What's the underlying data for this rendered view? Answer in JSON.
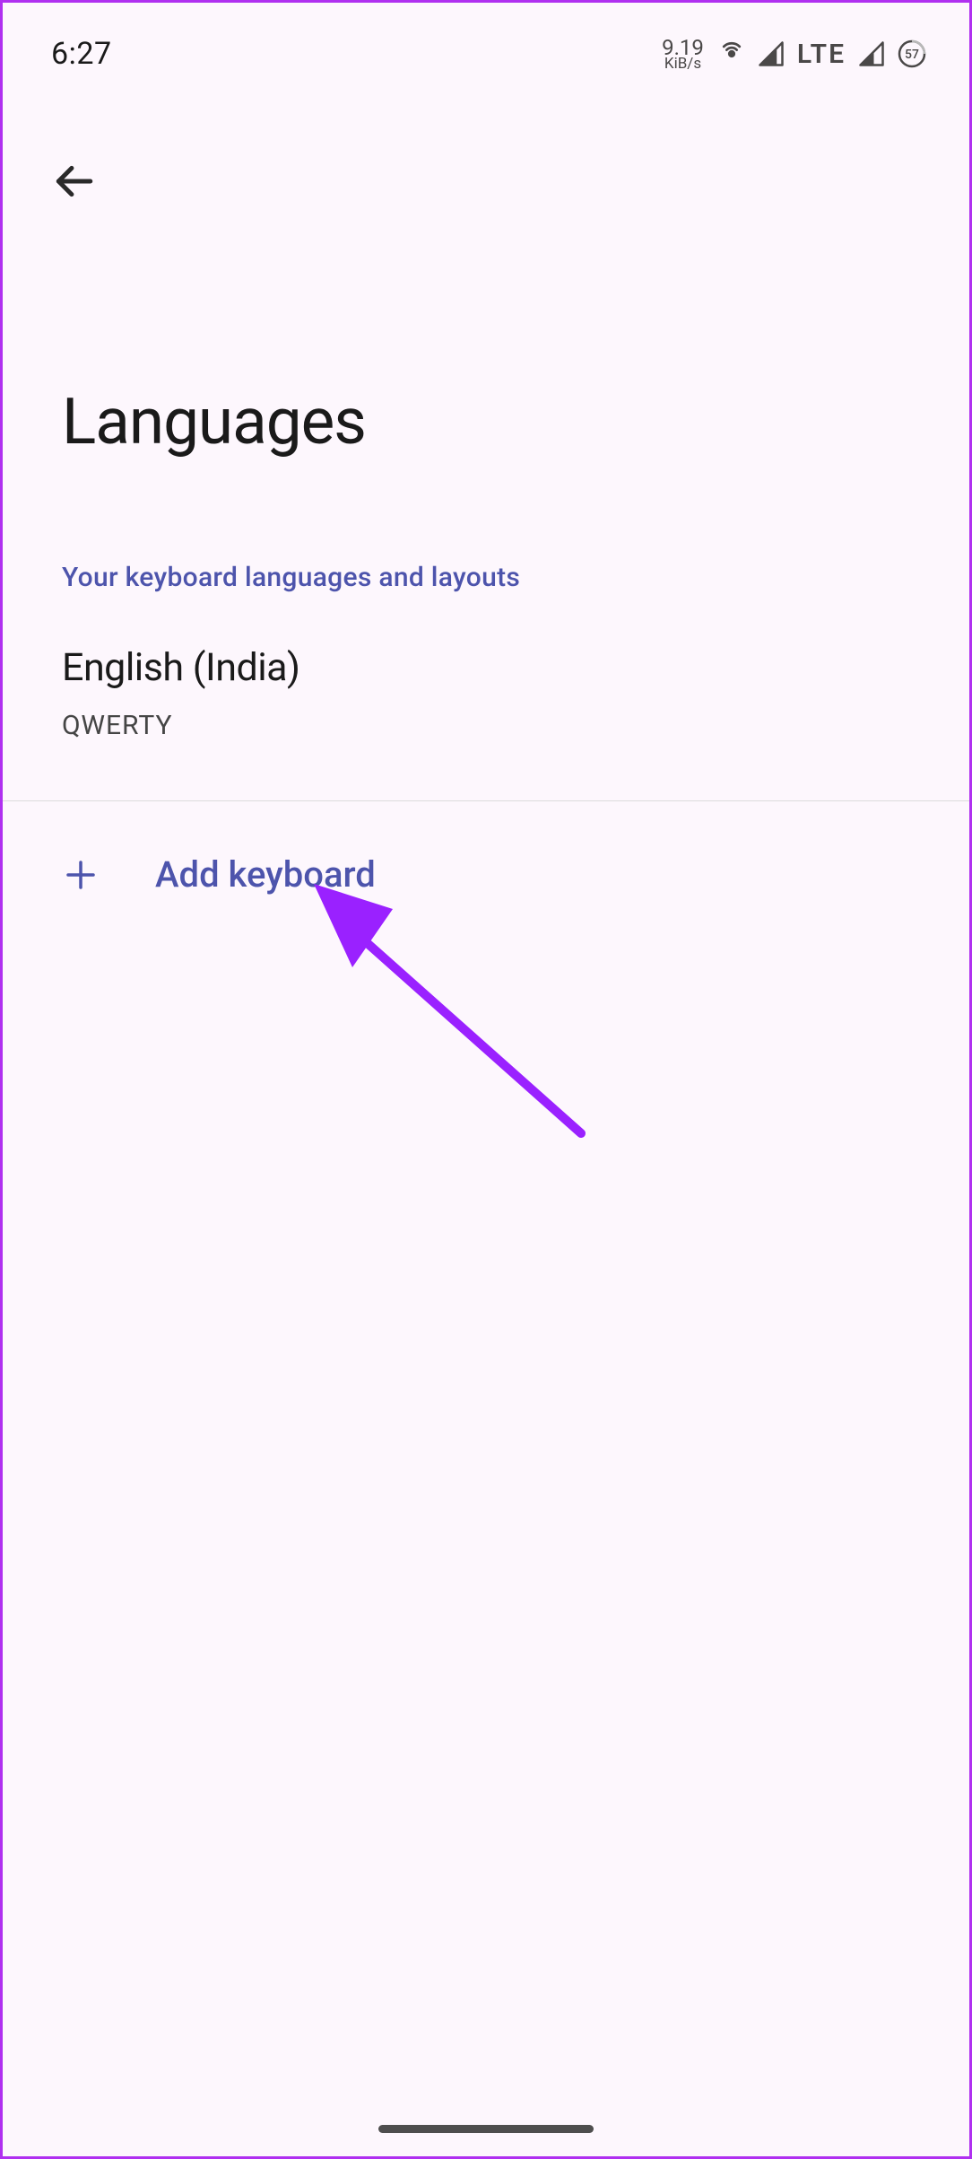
{
  "status_bar": {
    "time": "6:27",
    "data_rate_value": "9.19",
    "data_rate_unit": "KiB/s",
    "network": "LTE",
    "battery": "57"
  },
  "header": {
    "title": "Languages",
    "subtitle": "Your keyboard languages and layouts"
  },
  "languages": [
    {
      "name": "English (India)",
      "layout": "QWERTY"
    }
  ],
  "actions": {
    "add_keyboard": "Add keyboard"
  },
  "colors": {
    "accent": "#4d54ac",
    "annotation": "#9a21ff"
  }
}
